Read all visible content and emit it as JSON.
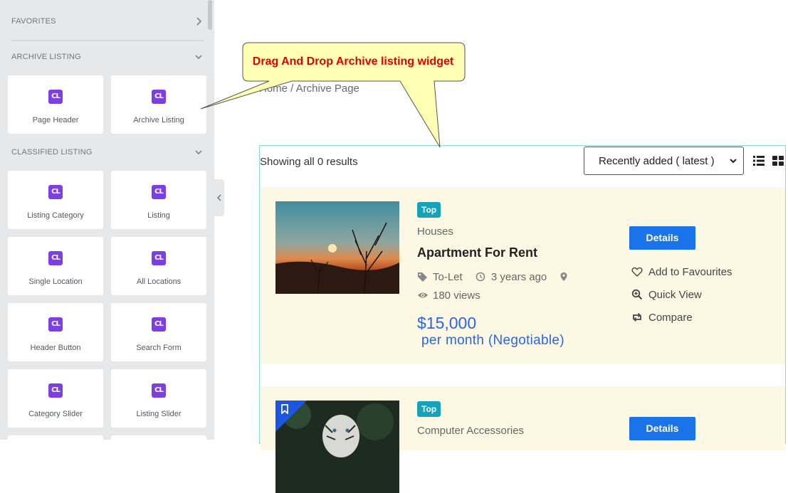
{
  "sidebar": {
    "favorites": {
      "title": "FAVORITES",
      "icon": "chevron-right-icon"
    },
    "archive_listing": {
      "title": "ARCHIVE LISTING",
      "icon": "chevron-down-icon",
      "tiles": [
        {
          "label": "Page Header",
          "icon_text": "CL"
        },
        {
          "label": "Archive Listing",
          "icon_text": "CL"
        }
      ]
    },
    "classified_listing": {
      "title": "CLASSIFIED LISTING",
      "icon": "chevron-down-icon",
      "tiles": [
        {
          "label": "Listing Category",
          "icon_text": "CL"
        },
        {
          "label": "Listing",
          "icon_text": "CL"
        },
        {
          "label": "Single Location",
          "icon_text": "CL"
        },
        {
          "label": "All Locations",
          "icon_text": "CL"
        },
        {
          "label": "Header Button",
          "icon_text": "CL"
        },
        {
          "label": "Search Form",
          "icon_text": "CL"
        },
        {
          "label": "Category Slider",
          "icon_text": "CL"
        },
        {
          "label": "Listing Slider",
          "icon_text": "CL"
        }
      ]
    },
    "accent_color": "#7b3fe4"
  },
  "callout": {
    "text": "Drag And Drop Archive listing widget",
    "color": "#e00000"
  },
  "breadcrumb": {
    "text": "Home / Archive Page"
  },
  "archive": {
    "result_count": "Showing all 0 results",
    "sort": {
      "selected": "Recently added ( latest )"
    },
    "listings": [
      {
        "badge": "Top",
        "category": "Houses",
        "title": "Apartment For Rent",
        "type": "To-Let",
        "posted": "3 years ago",
        "views": "180 views",
        "price": "$15,000",
        "period": "per month (Negotiable)",
        "details_label": "Details",
        "actions": [
          "Add to Favourites",
          "Quick View",
          "Compare"
        ]
      },
      {
        "badge": "Top",
        "category": "Computer Accessories",
        "details_label": "Details"
      }
    ],
    "colors": {
      "badge": "#17a2b8",
      "button": "#1a73e8",
      "price": "#2a66e0",
      "card_bg": "#fdf8e4"
    }
  }
}
